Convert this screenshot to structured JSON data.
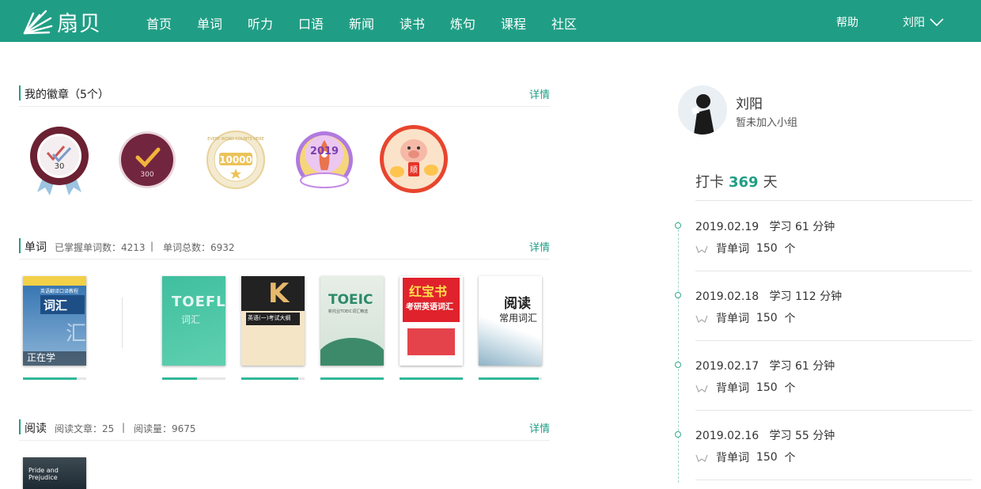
{
  "header": {
    "logo_text": "扇贝",
    "nav": [
      "首页",
      "单词",
      "听力",
      "口语",
      "新闻",
      "读书",
      "炼句",
      "课程",
      "社区"
    ],
    "help": "帮助",
    "user": "刘阳"
  },
  "badges_section": {
    "title": "我的徽章（5个）",
    "detail": "详情",
    "badges": [
      {
        "name": "badge-30",
        "label": "30"
      },
      {
        "name": "badge-300",
        "label": "300"
      },
      {
        "name": "badge-10000",
        "label": "10000",
        "ring_text": "EVERY WORD COUNTS HERE"
      },
      {
        "name": "badge-2019",
        "label": "2019"
      },
      {
        "name": "badge-pig",
        "label": "顺"
      }
    ]
  },
  "words_section": {
    "title": "单词",
    "mastered": "已掌握单词数：4213",
    "sep": "|",
    "total": "单词总数：6932",
    "detail": "详情",
    "current_label": "正在学",
    "books": [
      {
        "title": "词汇",
        "top": "英语翻译口译教程",
        "sub": "汇",
        "progress": 0.85
      },
      {
        "title": "TOEFL",
        "sub": "词汇",
        "progress": 0.55
      },
      {
        "title": "英语(一)考试大纲",
        "sub": "K",
        "progress": 0.9
      },
      {
        "title": "TOEIC",
        "sub": "新托业TOEIC词汇精选",
        "progress": 1.0
      },
      {
        "title": "红宝书",
        "sub": "考研英语词汇",
        "progress": 1.0
      },
      {
        "title": "阅读",
        "sub": "常用词汇",
        "progress": 0.95
      }
    ]
  },
  "reading_section": {
    "title": "阅读",
    "articles": "阅读文章：25",
    "sep": "|",
    "volume": "阅读量：9675",
    "detail": "详情",
    "book_title": "Pride and Prejudice"
  },
  "profile": {
    "name": "刘阳",
    "group": "暂未加入小组"
  },
  "checkin": {
    "prefix": "打卡",
    "days": "369",
    "suffix": "天"
  },
  "timeline": [
    {
      "date": "2019.02.19",
      "study": "学习 61 分钟",
      "action": "背单词",
      "count": "150",
      "unit": "个"
    },
    {
      "date": "2019.02.18",
      "study": "学习 112 分钟",
      "action": "背单词",
      "count": "150",
      "unit": "个"
    },
    {
      "date": "2019.02.17",
      "study": "学习 61 分钟",
      "action": "背单词",
      "count": "150",
      "unit": "个"
    },
    {
      "date": "2019.02.16",
      "study": "学习 55 分钟",
      "action": "背单词",
      "count": "150",
      "unit": "个"
    }
  ],
  "colors": {
    "brand": "#209e85",
    "accent": "#31b89a"
  }
}
